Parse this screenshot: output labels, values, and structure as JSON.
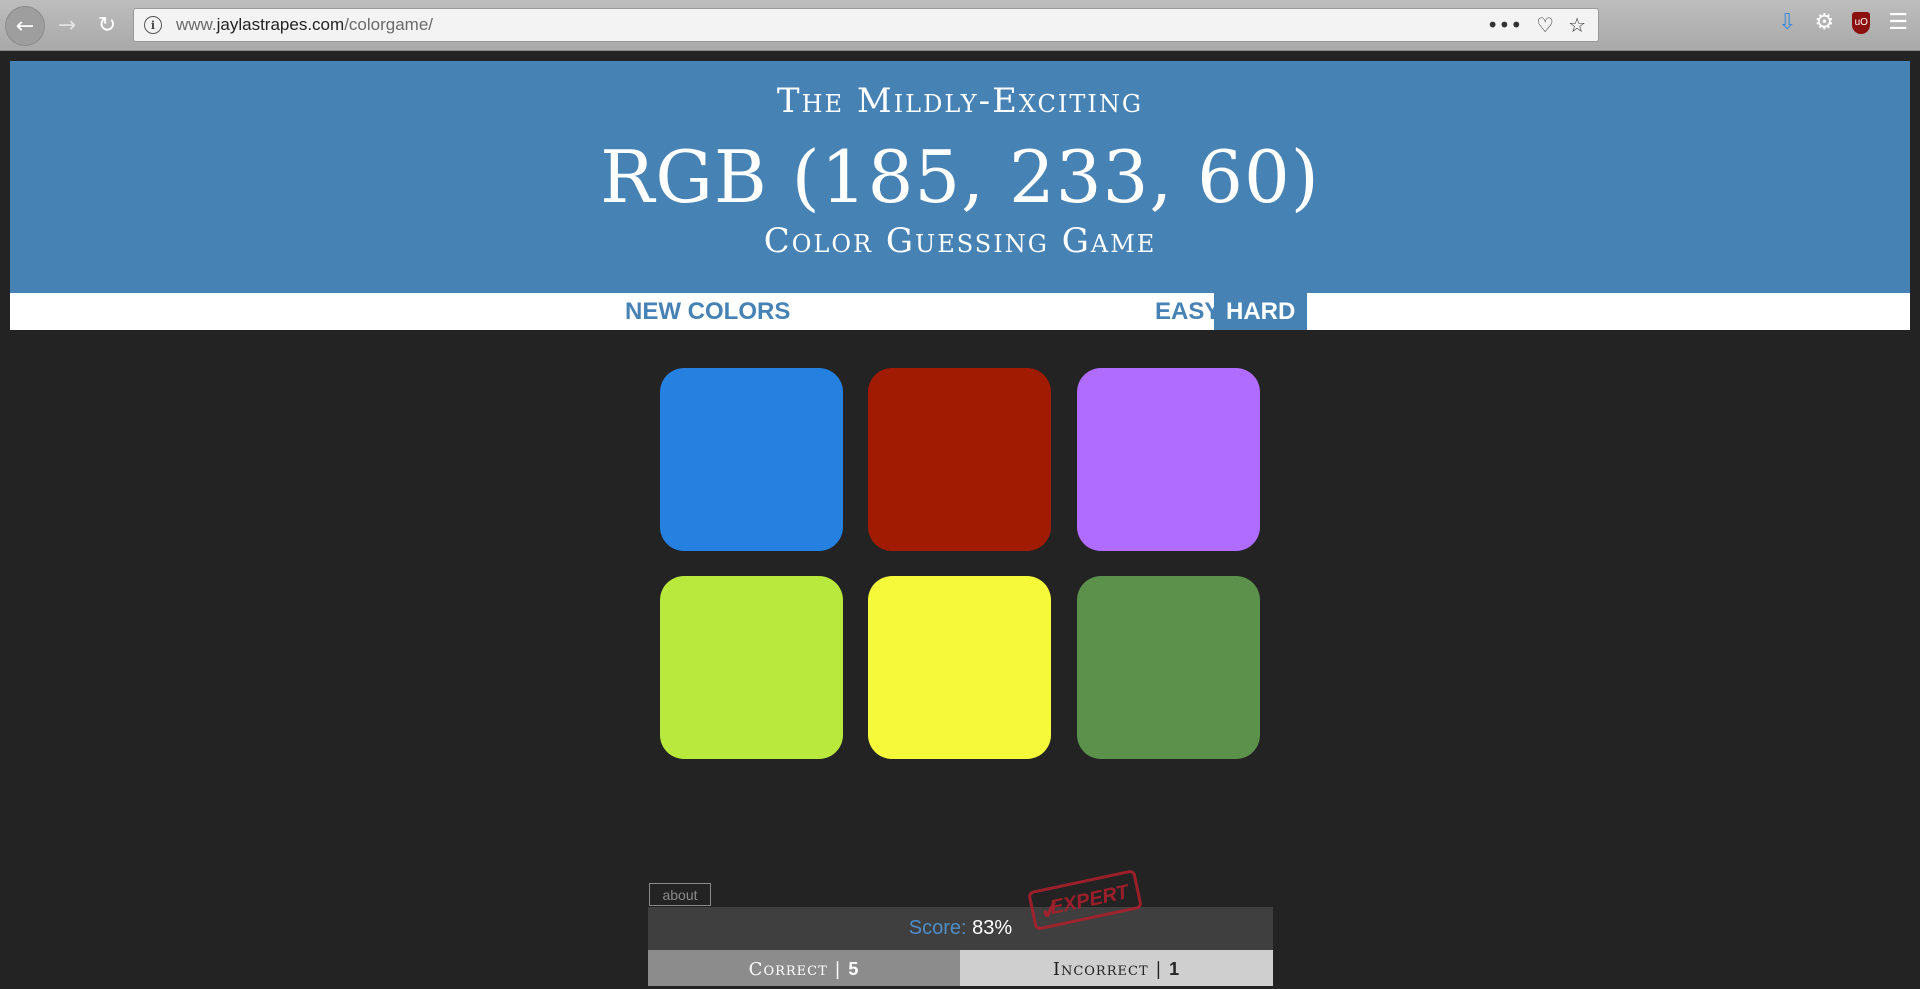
{
  "browser": {
    "url_prefix": "www.",
    "url_host": "jaylastrapes.com",
    "url_path": "/colorgame/",
    "icons": [
      "back-arrow-icon",
      "forward-arrow-icon",
      "reload-icon",
      "info-icon",
      "more-actions-icon",
      "pocket-icon",
      "bookmark-star-icon",
      "download-icon",
      "gear-icon",
      "ublock-icon",
      "hamburger-menu-icon"
    ]
  },
  "header": {
    "line1": "The Mildly-Exciting",
    "rgb": "RGB (185, 233, 60)",
    "line3": "Color Guessing Game",
    "background": "#4682b4"
  },
  "stripe": {
    "new_colors": "NEW COLORS",
    "easy": "EASY",
    "hard": "HARD",
    "selected_mode": "HARD"
  },
  "squares": [
    {
      "color": "#2580e0"
    },
    {
      "color": "#a11a02"
    },
    {
      "color": "#b06bff"
    },
    {
      "color": "#b9e93c"
    },
    {
      "color": "#f5f93a"
    },
    {
      "color": "#5c914c"
    }
  ],
  "footer": {
    "about": "about",
    "score_label": "Score:",
    "score_value": "83%",
    "stamp_text": "EXPERT",
    "correct_label": "Correct |",
    "correct_count": "5",
    "incorrect_label": "Incorrect |",
    "incorrect_count": "1"
  }
}
